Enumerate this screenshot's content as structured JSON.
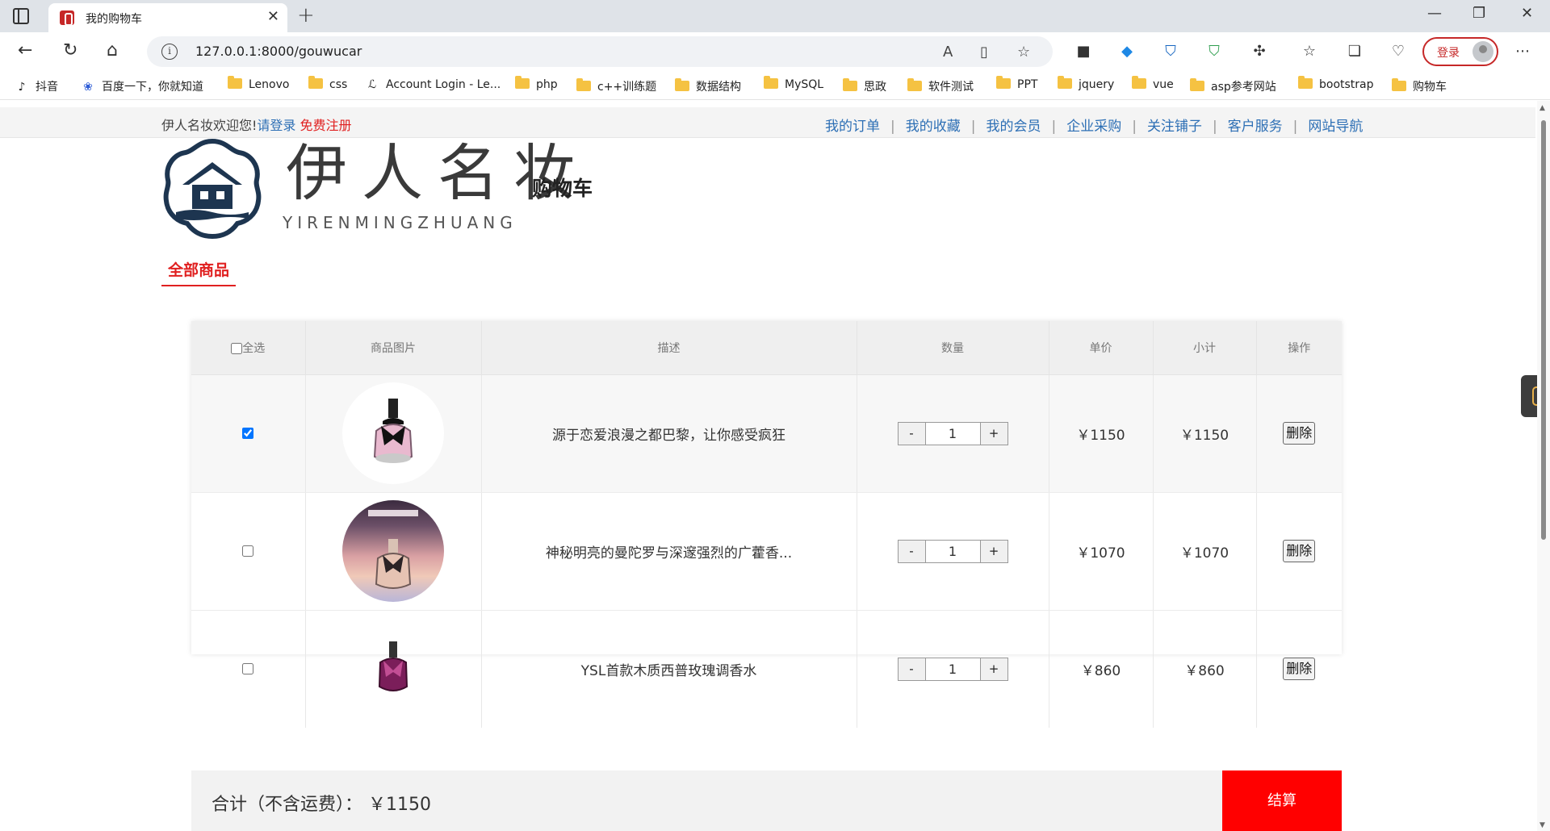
{
  "browser": {
    "tab_title": "我的购物车",
    "url": "127.0.0.1:8000/gouwucar",
    "login_label": "登录",
    "bookmarks": [
      "抖音",
      "百度一下，你就知道",
      "Lenovo",
      "css",
      "Account Login - Le...",
      "php",
      "c++训练题",
      "数据结构",
      "MySQL",
      "思政",
      "软件测试",
      "PPT",
      "jquery",
      "vue",
      "asp参考网站",
      "bootstrap",
      "购物车"
    ]
  },
  "topbar": {
    "welcome": "伊人名妆欢迎您!",
    "login_link": "请登录",
    "register_link": "免费注册",
    "links": [
      "我的订单",
      "我的收藏",
      "我的会员",
      "企业采购",
      "关注铺子",
      "客户服务",
      "网站导航"
    ]
  },
  "header": {
    "brand_cn": "伊人名妆",
    "brand_en": "YIRENMINGZHUANG",
    "page_title": "购物车"
  },
  "tab_label": "全部商品",
  "cart": {
    "headers": {
      "select_all": "全选",
      "image": "商品图片",
      "desc": "描述",
      "qty": "数量",
      "price": "单价",
      "subtotal": "小计",
      "action": "操作"
    },
    "minus": "-",
    "plus": "+",
    "delete_label": "删除",
    "items": [
      {
        "checked": true,
        "desc": "源于恋爱浪漫之都巴黎，让你感受疯狂",
        "qty": "1",
        "price": "￥1150",
        "subtotal": "￥1150"
      },
      {
        "checked": false,
        "desc": "神秘明亮的曼陀罗与深邃强烈的广藿香...",
        "qty": "1",
        "price": "￥1070",
        "subtotal": "￥1070"
      },
      {
        "checked": false,
        "desc": "YSL首款木质西普玫瑰调香水",
        "qty": "1",
        "price": "￥860",
        "subtotal": "￥860"
      }
    ]
  },
  "summary": {
    "total_label": "合计（不含运费）：",
    "total_value": "￥1150",
    "checkout_label": "结算"
  },
  "colors": {
    "accent": "#e02020",
    "link": "#2d6fb5",
    "checkout": "#ff0000"
  }
}
